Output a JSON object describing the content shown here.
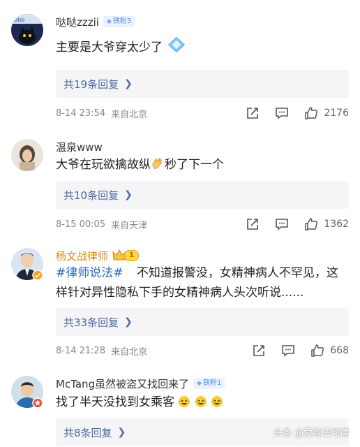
{
  "comments": [
    {
      "username": "哒哒zzzii",
      "badge": "铁粉3",
      "text": "主要是大爷穿太少了",
      "replies": "共19条回复",
      "time": "8-14 23:54",
      "location": "来自北京",
      "likes": "2176"
    },
    {
      "username": "温泉www",
      "text_before": "大爷在玩欲擒故纵",
      "text_after": "秒了下一个",
      "replies": "共10条回复",
      "time": "8-15 00:05",
      "location": "来自天津",
      "likes": "1362"
    },
    {
      "username": "杨文战律师",
      "level": "1",
      "hashtag": "#律师说法#",
      "text": "不知道报警没，女精神病人不罕见，这样针对异性隐私下手的女精神病人头次听说......",
      "replies": "共33条回复",
      "time": "8-14 21:28",
      "location": "来自北京",
      "likes": "668"
    },
    {
      "username": "McTang虽然被盗又找回来了",
      "badge": "铁粉1",
      "text": "找了半天没找到女乘客",
      "replies": "共8条回复"
    }
  ],
  "watermark": "头条 @爱普法何律",
  "colors": {
    "reply_bg": "#f5f5f7",
    "reply_text": "#4a6a9c",
    "vip_name": "#e0891a",
    "hashtag": "#2c66b8",
    "badge_bg": "#eaf2ff"
  }
}
